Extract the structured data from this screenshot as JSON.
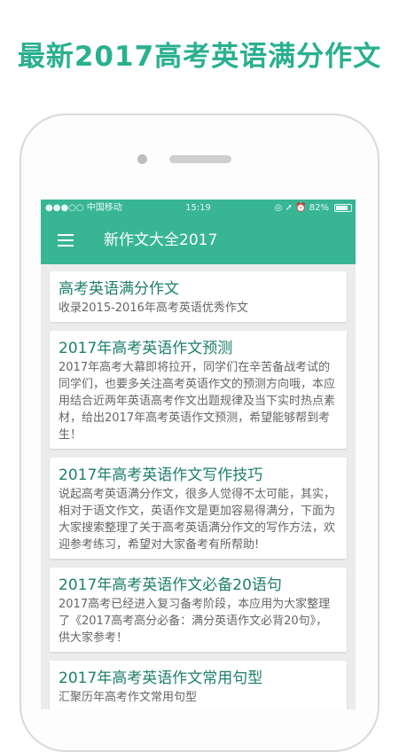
{
  "promo": {
    "headline": "最新2017高考英语满分作文"
  },
  "status_bar": {
    "carrier": "●●●○○ 中国移动",
    "time": "15:19",
    "battery_percent_text": "82%",
    "battery_level": 0.82,
    "right_icons": "◎ ➚ ⏰"
  },
  "app_bar": {
    "title": "新作文大全2017",
    "menu_icon": "menu-icon"
  },
  "colors": {
    "accent": "#38b595",
    "title_text": "#1f7f6d",
    "promo_text": "#29b08f"
  },
  "articles": [
    {
      "title": "高考英语满分作文",
      "summary": "收录2015-2016年高考英语优秀作文"
    },
    {
      "title": "2017年高考英语作文预测",
      "summary": "2017年高考大幕即将拉开，同学们在辛苦备战考试的同学们，也要多关注高考英语作文的预测方向哦，本应用结合近两年英语高考作文出题规律及当下实时热点素材，给出2017年高考英语作文预测，希望能够帮到考生！"
    },
    {
      "title": "2017年高考英语作文写作技巧",
      "summary": "说起高考英语满分作文，很多人觉得不太可能，其实，相对于语文作文，英语作文是更加容易得满分，下面为大家搜索整理了关于高考英语满分作文的写作方法，欢迎参考练习，希望对大家备考有所帮助!"
    },
    {
      "title": "2017年高考英语作文必备20语句",
      "summary": "2017高考已经进入复习备考阶段，本应用为大家整理了《2017高考高分必备：满分英语作文必背20句》，供大家参考！"
    },
    {
      "title": "2017年高考英语作文常用句型",
      "summary": "汇聚历年高考作文常用句型"
    }
  ]
}
